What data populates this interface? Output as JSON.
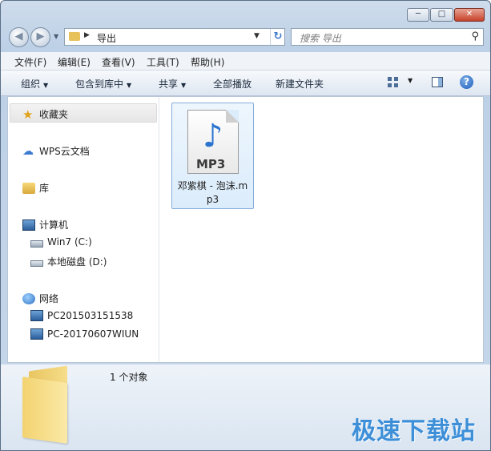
{
  "window": {
    "controls": {
      "minimize": "─",
      "maximize": "□",
      "close": "✕"
    }
  },
  "address": {
    "path": "导出",
    "search_placeholder": "搜索 导出"
  },
  "menu": [
    "文件(F)",
    "编辑(E)",
    "查看(V)",
    "工具(T)",
    "帮助(H)"
  ],
  "toolbar": {
    "organize": "组织",
    "include_in_library": "包含到库中",
    "share": "共享",
    "play_all": "全部播放",
    "new_folder": "新建文件夹"
  },
  "nav": {
    "favorites": "收藏夹",
    "wps_cloud": "WPS云文档",
    "libraries": "库",
    "computer": "计算机",
    "drive_c": "Win7 (C:)",
    "drive_d": "本地磁盘 (D:)",
    "network": "网络",
    "net_pc1": "PC201503151538",
    "net_pc2": "PC-20170607WIUN"
  },
  "files": [
    {
      "name": "邓紫棋 - 泡沫.mp3",
      "badge": "MP3",
      "icon": "music-note-icon"
    }
  ],
  "details": {
    "count": "1 个对象"
  },
  "watermark": "极速下载站",
  "colors": {
    "accent": "#3d8fd8",
    "selection": "#dbecfb"
  }
}
